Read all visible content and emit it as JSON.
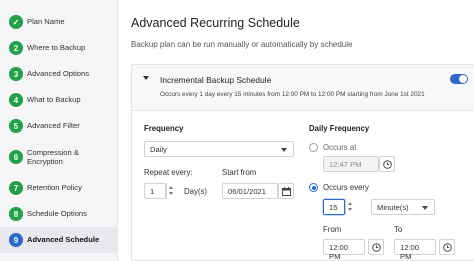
{
  "sidebar": {
    "steps": [
      {
        "number": "✓",
        "label": "Plan Name"
      },
      {
        "number": "2",
        "label": "Where to Backup"
      },
      {
        "number": "3",
        "label": "Advanced Options"
      },
      {
        "number": "4",
        "label": "What to Backup"
      },
      {
        "number": "5",
        "label": "Advanced Filter"
      },
      {
        "number": "6",
        "label": "Compression & Encryption"
      },
      {
        "number": "7",
        "label": "Retention Policy"
      },
      {
        "number": "8",
        "label": "Schedule Options"
      },
      {
        "number": "9",
        "label": "Advanced Schedule",
        "active": true
      }
    ]
  },
  "main": {
    "title": "Advanced Recurring Schedule",
    "description": "Backup plan can be run manually or automatically by schedule"
  },
  "schedule": {
    "title": "Incremental Backup Schedule",
    "summary": "Occurs every 1 day every 15 minutes from 12:00 PM to 12:00 PM starting from June 1st 2021",
    "enabled": true
  },
  "frequency": {
    "label": "Frequency",
    "value": "Daily",
    "repeat_label": "Repeat every:",
    "repeat_value": "1",
    "repeat_unit": "Day(s)",
    "start_label": "Start from",
    "start_value": "06/01/2021"
  },
  "daily_frequency": {
    "label": "Daily Frequency",
    "occurs_at_label": "Occurs at",
    "occurs_at_value": "12:47 PM",
    "occurs_every_label": "Occurs every",
    "occurs_every_value": "15",
    "occurs_every_unit": "Minute(s)",
    "from_label": "From",
    "from_value": "12:00 PM",
    "to_label": "To",
    "to_value": "12:00 PM",
    "selected": "occurs_every"
  },
  "colors": {
    "accent": "#2e68c9",
    "done": "#22a04b"
  }
}
